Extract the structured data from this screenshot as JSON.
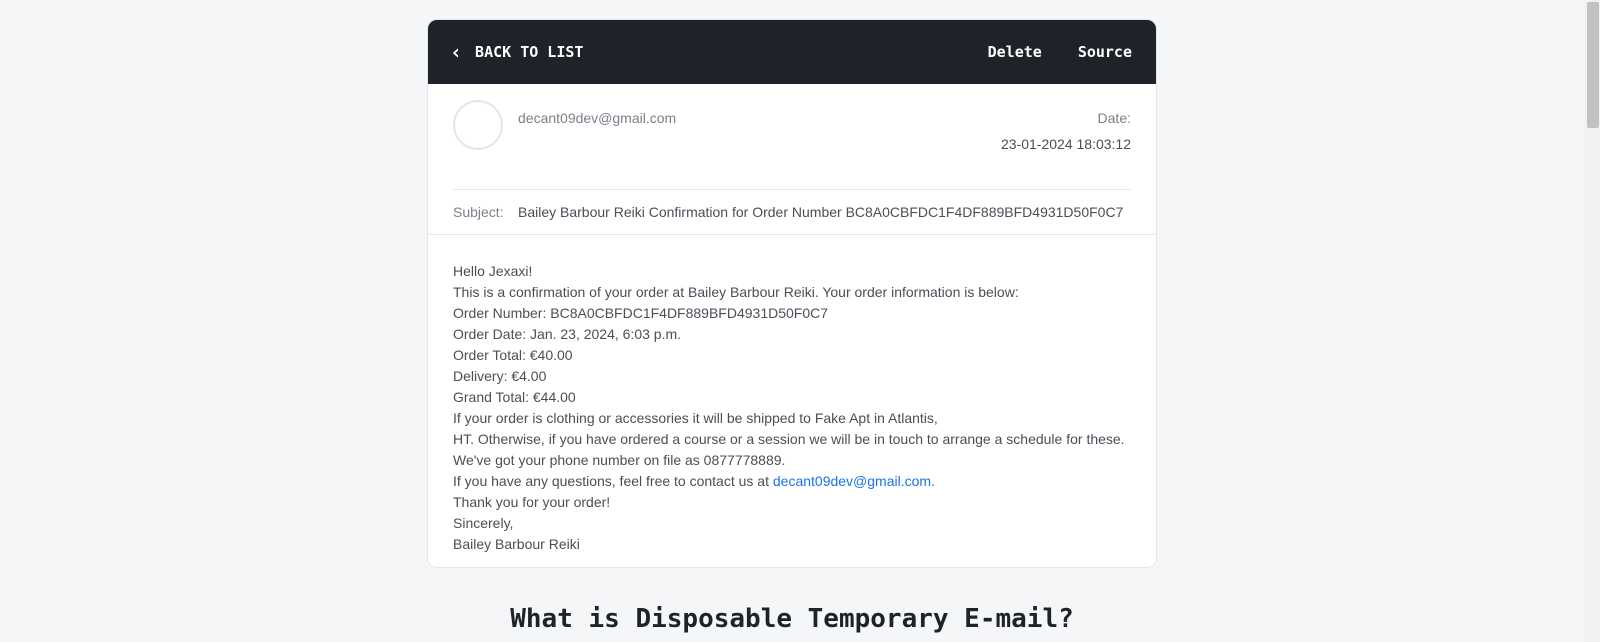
{
  "toolbar": {
    "back_label": "BACK TO LIST",
    "delete_label": "Delete",
    "source_label": "Source"
  },
  "header": {
    "sender": "decant09dev@gmail.com",
    "date_label": "Date:",
    "date_value": "23-01-2024 18:03:12",
    "subject_label": "Subject:",
    "subject_value": "Bailey Barbour Reiki Confirmation for Order Number BC8A0CBFDC1F4DF889BFD4931D50F0C7"
  },
  "body": {
    "lines": [
      "Hello Jexaxi!",
      "This is a confirmation of your order at Bailey Barbour Reiki. Your order information is below:",
      "Order Number: BC8A0CBFDC1F4DF889BFD4931D50F0C7",
      "Order Date: Jan. 23, 2024, 6:03 p.m.",
      "Order Total: €40.00",
      "Delivery: €4.00",
      "Grand Total: €44.00",
      "If your order is clothing or accessories it will be shipped to Fake Apt in Atlantis,",
      "HT. Otherwise, if you have ordered a course or a session we will be in touch to arrange a schedule for these.",
      "We've got your phone number on file as 0877778889."
    ],
    "contact_prefix": "If you have any questions, feel free to contact us at ",
    "contact_link": "decant09dev@gmail.com",
    "contact_suffix": ".",
    "closing": [
      "Thank you for your order!",
      "Sincerely,",
      "Bailey Barbour Reiki"
    ]
  },
  "footer": {
    "heading": "What is Disposable Temporary E-mail?"
  }
}
